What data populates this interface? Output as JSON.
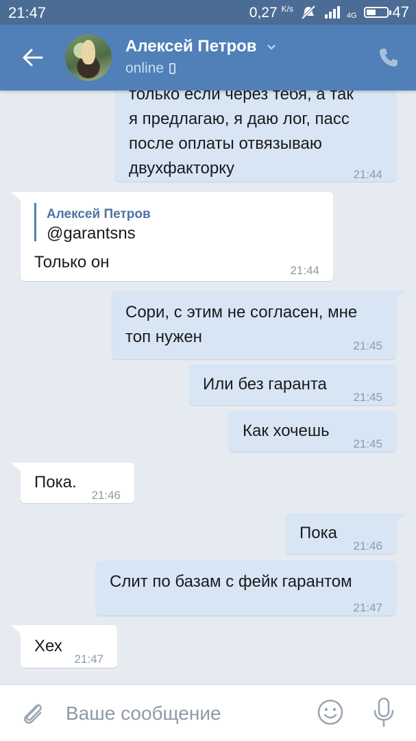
{
  "status_bar": {
    "time": "21:47",
    "speed_value": "0,27",
    "speed_unit": "K/s",
    "network_label": "4G",
    "battery_level": "47",
    "battery_fraction": 0.47,
    "icons": [
      "mute-icon",
      "signal-icon",
      "battery-icon"
    ]
  },
  "header": {
    "back_icon": "arrow-left-icon",
    "contact_name": "Алексей Петров",
    "status": "online",
    "status_icon": "mobile-phone-icon",
    "call_icon": "phone-icon"
  },
  "messages": [
    {
      "dir": "out",
      "lines": [
        "только если через тебя, а так",
        "я предлагаю, я даю лог, пасс",
        "после оплаты отвязываю",
        "двухфакторку"
      ],
      "time": "21:44"
    },
    {
      "dir": "in",
      "quote_author": "Алексей Петров",
      "quote_text": "@garantsns",
      "text": "Только он",
      "time": "21:44"
    },
    {
      "dir": "out",
      "lines": [
        "Сори, с этим не согласен, мне",
        "топ нужен"
      ],
      "time": "21:45"
    },
    {
      "dir": "out",
      "text": "Или без гаранта",
      "time": "21:45"
    },
    {
      "dir": "out",
      "text": "Как хочешь",
      "time": "21:45"
    },
    {
      "dir": "in",
      "text": "Пока.",
      "time": "21:46"
    },
    {
      "dir": "out",
      "text": "Пока",
      "time": "21:46"
    },
    {
      "dir": "out",
      "text": "Слит по базам с фейк гарантом",
      "time": "21:47"
    },
    {
      "dir": "in",
      "text": "Хех",
      "time": "21:47"
    }
  ],
  "composer": {
    "placeholder": "Ваше сообщение",
    "value": "",
    "attach_icon": "paperclip-icon",
    "emoji_icon": "smile-icon",
    "mic_icon": "microphone-icon"
  },
  "colors": {
    "status_bar": "#4b6c94",
    "header": "#5180b8",
    "background": "#e6ebf1",
    "outgoing_bubble": "#d7e5f5",
    "incoming_bubble": "#ffffff",
    "timestamp": "#8e9aa6",
    "quote_accent": "#5181b8"
  }
}
